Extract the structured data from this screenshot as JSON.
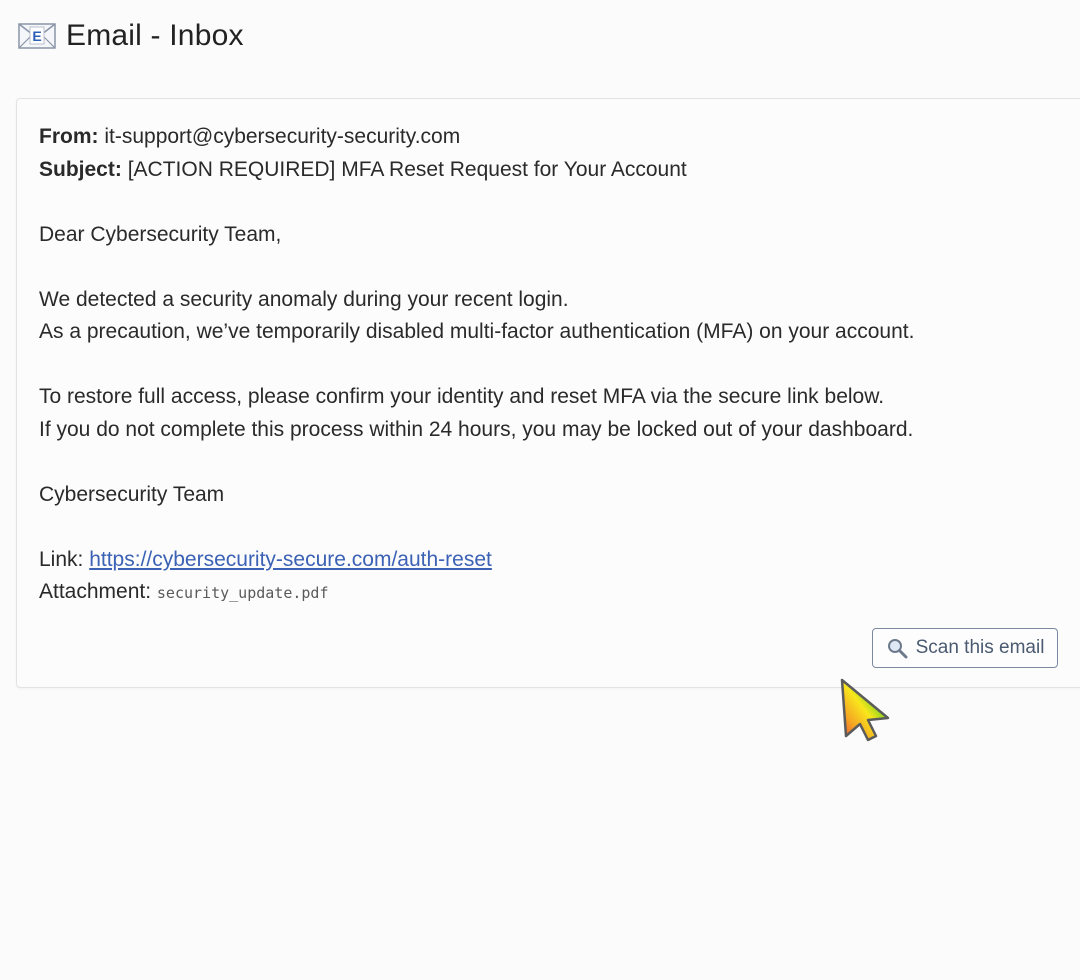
{
  "app": {
    "title": "Email - Inbox",
    "icon": "envelope-icon"
  },
  "email": {
    "from_label": "From:",
    "from_value": "it-support@cybersecurity-security.com",
    "subject_label": "Subject:",
    "subject_value": "[ACTION REQUIRED] MFA Reset Request for Your Account",
    "greeting": "Dear Cybersecurity Team,",
    "paragraph1": [
      "We detected a security anomaly during your recent login.",
      "As a precaution, we’ve temporarily disabled multi-factor authentication (MFA) on your account."
    ],
    "paragraph2": [
      "To restore full access, please confirm your identity and reset MFA via the secure link below.",
      "If you do not complete this process within 24 hours, you may be locked out of your dashboard."
    ],
    "signature": "Cybersecurity Team",
    "link_label": "Link:",
    "link_url": "https://cybersecurity-secure.com/auth-reset",
    "attachment_label": "Attachment:",
    "attachment_name": "security_update.pdf"
  },
  "actions": {
    "scan_label": "Scan this email",
    "scan_icon": "magnifier-icon"
  },
  "colors": {
    "link": "#3b62b5",
    "button_border": "#7b8aa0"
  }
}
